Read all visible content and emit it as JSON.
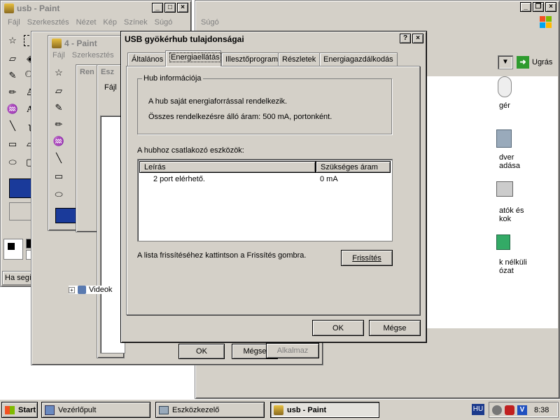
{
  "paint_main": {
    "title": "usb - Paint",
    "menu": [
      "Fájl",
      "Szerkesztés",
      "Nézet",
      "Kép",
      "Színek",
      "Súgó"
    ],
    "status": "Ha segítségre van szüksége, kattintson"
  },
  "bg_window": {
    "menu_help": "Súgó",
    "go_label": "Ugrás",
    "desktop_icons": [
      {
        "label": "gér"
      },
      {
        "label": "dver\nadása"
      },
      {
        "label": "atók és\nkok"
      },
      {
        "label": "k nélküli\nózat"
      }
    ]
  },
  "paint_second": {
    "title": "4 - Paint",
    "menu": [
      "Fájl",
      "Szerkesztés"
    ]
  },
  "device_manager": {
    "title_part": "Ren",
    "title_part2": "Esz",
    "menu_file": "Fájl",
    "tree_item": "Videok"
  },
  "props_bottom": {
    "ok": "OK",
    "cancel": "Mégse",
    "apply": "Alkalmaz"
  },
  "dialog": {
    "title": "USB gyökérhub tulajdonságai",
    "tabs": [
      "Általános",
      "Energiaellátás",
      "Illesztőprogram",
      "Részletek",
      "Energiagazdálkodás"
    ],
    "selected_tab": 1,
    "group_title": "Hub információja",
    "info_line1": "A hub saját energiaforrással rendelkezik.",
    "info_line2": "Összes rendelkezésre álló áram:  500 mA, portonként.",
    "list_label": "A hubhoz csatlakozó eszközök:",
    "col_desc": "Leírás",
    "col_current": "Szükséges áram",
    "rows": [
      {
        "desc": "2 port elérhető.",
        "current": "0 mA"
      }
    ],
    "refresh_hint": "A lista frissítéséhez kattintson a Frissítés gombra.",
    "refresh_button": "Frissítés",
    "ok": "OK",
    "cancel": "Mégse"
  },
  "taskbar": {
    "start": "Start",
    "items": [
      "Vezérlőpult",
      "Eszközkezelő",
      "usb - Paint"
    ],
    "lang": "HU",
    "clock": "8:38"
  },
  "palette": [
    "#000000",
    "#808080",
    "#800000",
    "#808000",
    "#008000",
    "#008080",
    "#000080",
    "#800080",
    "#808040",
    "#ffffff",
    "#c0c0c0",
    "#ff0000",
    "#ffff00",
    "#00ff00",
    "#00ffff",
    "#0000ff",
    "#ff00ff",
    "#ffff80"
  ]
}
